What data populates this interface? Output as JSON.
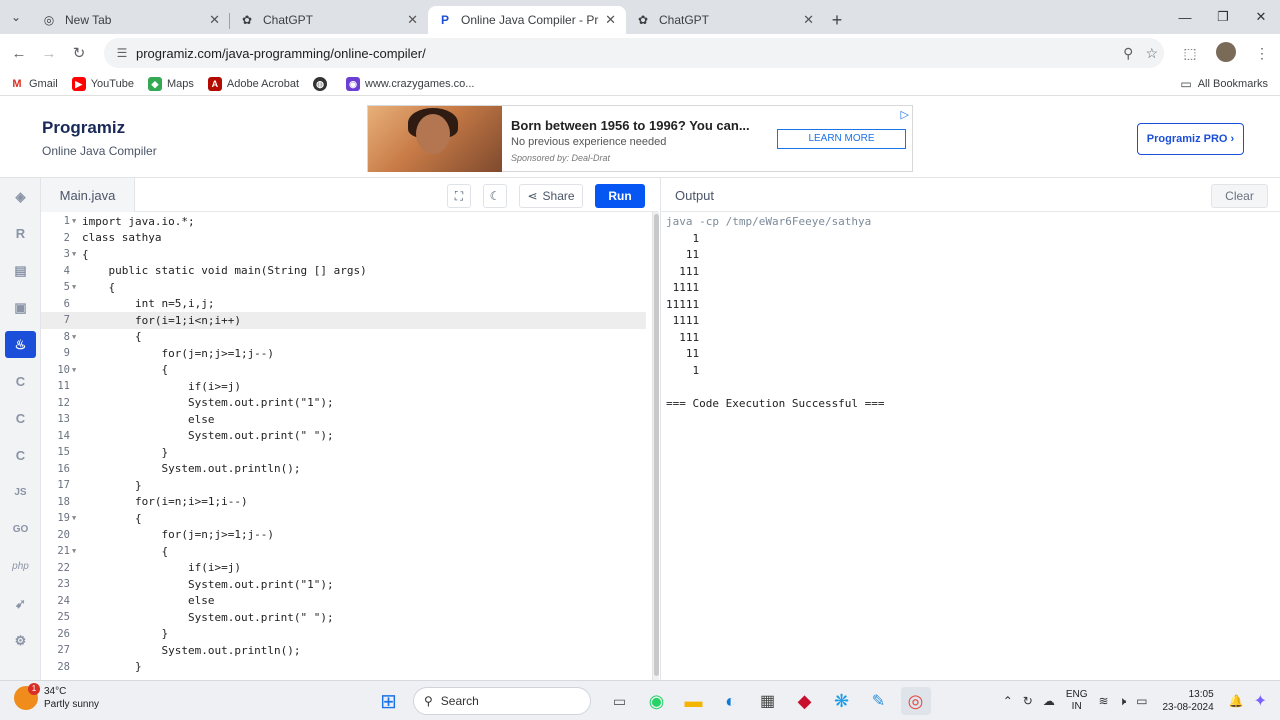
{
  "browser": {
    "tabs": [
      {
        "title": "New Tab",
        "icon": "chrome-icon",
        "active": false
      },
      {
        "title": "ChatGPT",
        "icon": "chatgpt-icon",
        "active": false
      },
      {
        "title": "Online Java Compiler - Program",
        "icon": "programiz-icon",
        "active": true
      },
      {
        "title": "ChatGPT",
        "icon": "chatgpt-icon",
        "active": false
      }
    ],
    "url": "programiz.com/java-programming/online-compiler/",
    "bookmarks": [
      "Gmail",
      "YouTube",
      "Maps",
      "Adobe Acrobat",
      "www.crazygames.co..."
    ],
    "all_bookmarks": "All Bookmarks"
  },
  "site": {
    "logo": "Programiz",
    "subtitle": "Online Java Compiler",
    "pro_button": "Programiz PRO ›"
  },
  "ad": {
    "headline": "Born between 1956 to 1996? You can...",
    "desc": "No previous experience needed",
    "sponsor": "Sponsored by: Deal-Drat",
    "cta": "LEARN MORE"
  },
  "sidebar": {
    "items": [
      "python-icon",
      "r-icon",
      "sql-icon",
      "html-icon",
      "java-icon",
      "c-icon",
      "cpp-icon",
      "csharp-icon",
      "js-icon",
      "go-icon",
      "php-icon",
      "swift-icon",
      "rust-icon"
    ],
    "labels": [
      "",
      "",
      "",
      "",
      "",
      "",
      "",
      "",
      "JS",
      "GO",
      "php",
      "",
      ""
    ]
  },
  "editor": {
    "filename": "Main.java",
    "share_label": "Share",
    "run_label": "Run",
    "current_line": 7,
    "lines": [
      "import java.io.*;",
      "class sathya",
      "{",
      "    public static void main(String [] args)",
      "    {",
      "        int n=5,i,j;",
      "        for(i=1;i<n;i++)",
      "        {",
      "            for(j=n;j>=1;j--)",
      "            {",
      "                if(i>=j)",
      "                System.out.print(\"1\");",
      "                else",
      "                System.out.print(\" \");",
      "            }",
      "            System.out.println();",
      "        }",
      "        for(i=n;i>=1;i--)",
      "        {",
      "            for(j=n;j>=1;j--)",
      "            {",
      "                if(i>=j)",
      "                System.out.print(\"1\");",
      "                else",
      "                System.out.print(\" \");",
      "            }",
      "            System.out.println();",
      "        }"
    ],
    "folds": [
      1,
      3,
      5,
      8,
      10,
      19,
      21
    ]
  },
  "output": {
    "title": "Output",
    "clear_label": "Clear",
    "command": "java -cp /tmp/eWar6Feeye/sathya",
    "lines": [
      "    1",
      "   11",
      "  111",
      " 1111",
      "11111",
      " 1111",
      "  111",
      "   11",
      "    1",
      "",
      "=== Code Execution Successful ==="
    ]
  },
  "taskbar": {
    "temp": "34°C",
    "weather": "Partly sunny",
    "weather_badge": "1",
    "search": "Search",
    "lang": "ENG",
    "region": "IN",
    "time": "13:05",
    "date": "23-08-2024"
  },
  "colors": {
    "accent": "#0556f3",
    "brand": "#1b4fd9"
  }
}
